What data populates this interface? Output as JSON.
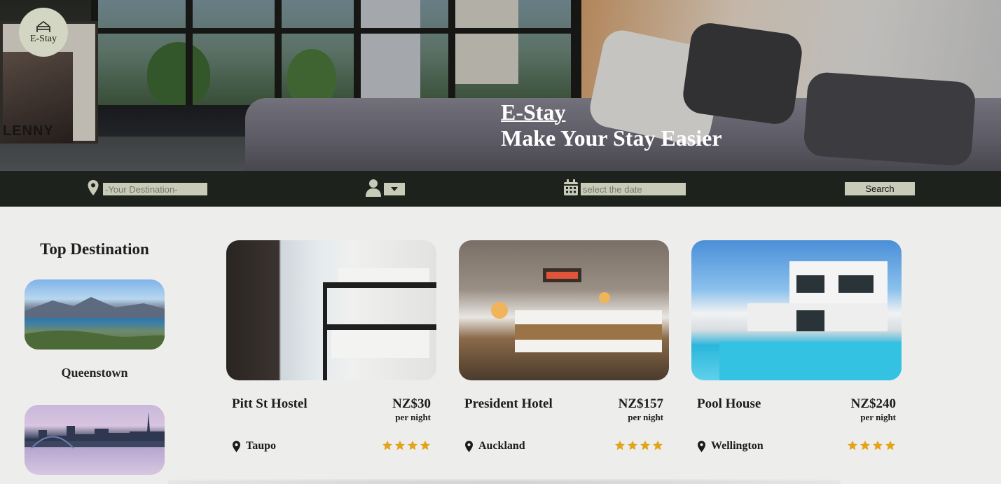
{
  "brand": {
    "logo_text": "E-Stay",
    "logo_icon": "bed-icon"
  },
  "hero": {
    "title": "E-Stay",
    "tagline": "Make Your Stay Easier",
    "poster_text": "LENNY"
  },
  "search": {
    "destination_placeholder": "-Your Destination-",
    "date_placeholder": "select the date",
    "guests_selected": "",
    "button_label": "Search",
    "icons": [
      "map-pin-icon",
      "user-icon",
      "calendar-icon"
    ]
  },
  "sidebar": {
    "title": "Top Destination",
    "destinations": [
      {
        "label": "Queenstown"
      },
      {
        "label": ""
      }
    ]
  },
  "listings": [
    {
      "name": "Pitt St Hostel",
      "price": "NZ$30",
      "unit": "per night",
      "location": "Taupo",
      "rating": 4
    },
    {
      "name": "President Hotel",
      "price": "NZ$157",
      "unit": "per night",
      "location": "Auckland",
      "rating": 4
    },
    {
      "name": "Pool House",
      "price": "NZ$240",
      "unit": "per night",
      "location": "Wellington",
      "rating": 4
    }
  ],
  "colors": {
    "searchbar_bg": "#1e221c",
    "input_bg": "#c7cbb8",
    "page_bg": "#ededeb",
    "star": "#e3a31a"
  }
}
